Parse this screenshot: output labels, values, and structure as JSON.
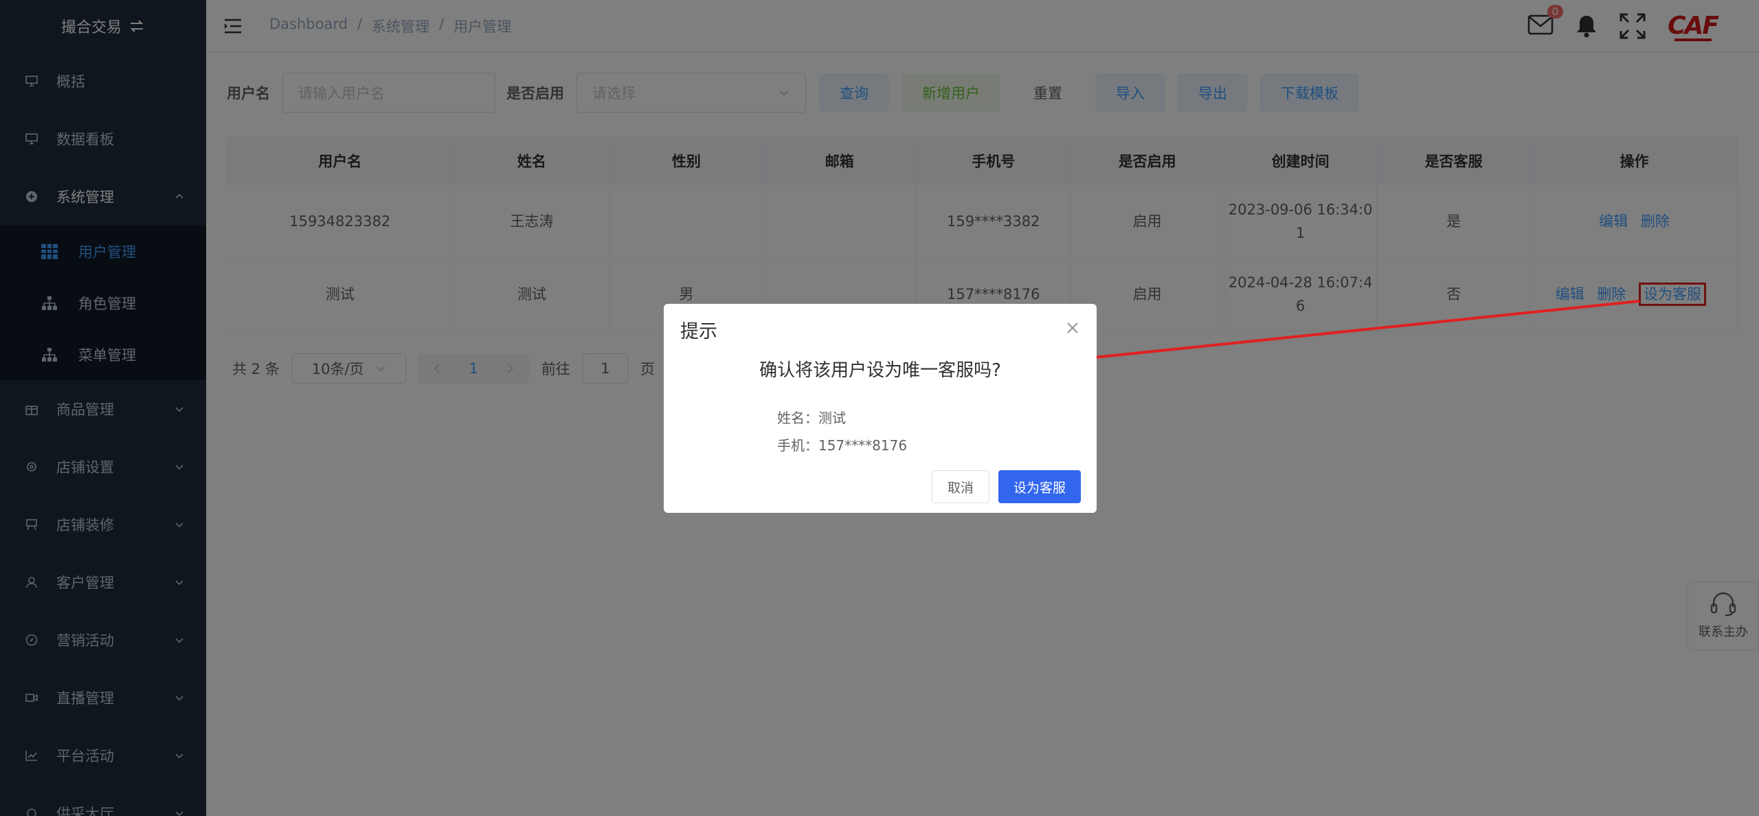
{
  "sidebar": {
    "brand": "撮合交易",
    "items": [
      {
        "label": "概括"
      },
      {
        "label": "数据看板"
      },
      {
        "label": "系统管理"
      },
      {
        "label": "商品管理"
      },
      {
        "label": "店铺设置"
      },
      {
        "label": "店铺装修"
      },
      {
        "label": "客户管理"
      },
      {
        "label": "营销活动"
      },
      {
        "label": "直播管理"
      },
      {
        "label": "平台活动"
      },
      {
        "label": "供采大厅"
      }
    ],
    "submenu": [
      {
        "label": "用户管理"
      },
      {
        "label": "角色管理"
      },
      {
        "label": "菜单管理"
      }
    ]
  },
  "header": {
    "breadcrumb": [
      "Dashboard",
      "/",
      "系统管理",
      "/",
      "用户管理"
    ],
    "mail_badge": "0",
    "logo": "CAF"
  },
  "filter": {
    "username_label": "用户名",
    "username_placeholder": "请输入用户名",
    "enabled_label": "是否启用",
    "enabled_placeholder": "请选择",
    "buttons": {
      "query": "查询",
      "add": "新增用户",
      "reset": "重置",
      "import": "导入",
      "export": "导出",
      "download": "下载模板"
    }
  },
  "table": {
    "headers": [
      "用户名",
      "姓名",
      "性别",
      "邮箱",
      "手机号",
      "是否启用",
      "创建时间",
      "是否客服",
      "操作"
    ],
    "rows": [
      {
        "username": "15934823382",
        "name": "王志涛",
        "gender": "",
        "email": "",
        "phone": "159****3382",
        "enabled": "启用",
        "created_1": "2023-09-06 16:34:0",
        "created_2": "1",
        "is_cs": "是",
        "ops": [
          "编辑",
          "删除"
        ]
      },
      {
        "username": "测试",
        "name": "测试",
        "gender": "男",
        "email": "",
        "phone": "157****8176",
        "enabled": "启用",
        "created_1": "2024-04-28 16:07:4",
        "created_2": "6",
        "is_cs": "否",
        "ops": [
          "编辑",
          "删除",
          "设为客服"
        ]
      }
    ]
  },
  "pager": {
    "total": "共 2 条",
    "page_size": "10条/页",
    "current": "1",
    "goto_label": "前往",
    "goto_value": "1",
    "page_unit": "页"
  },
  "contact": {
    "label": "联系主办"
  },
  "dialog": {
    "title": "提示",
    "message": "确认将该用户设为唯一客服吗?",
    "name_line": "姓名：测试",
    "phone_line": "手机：157****8176",
    "cancel": "取消",
    "confirm": "设为客服"
  }
}
